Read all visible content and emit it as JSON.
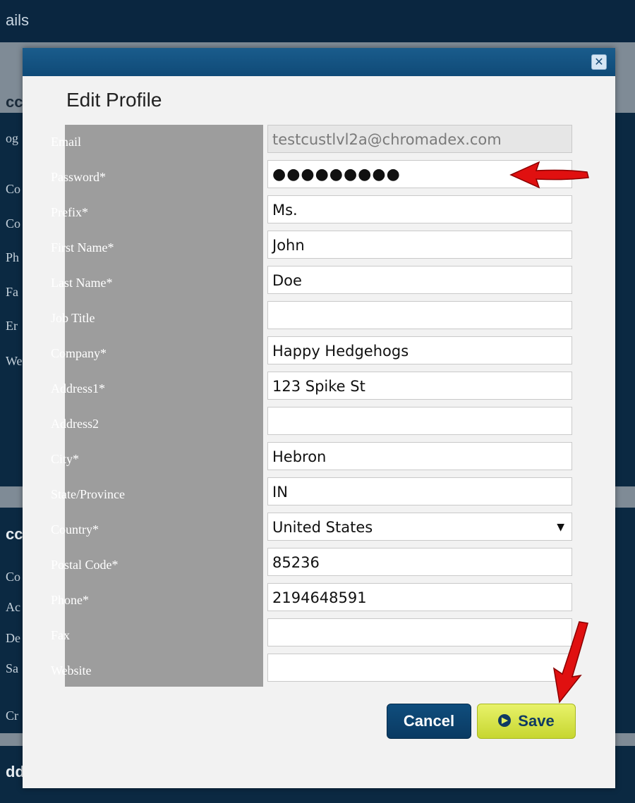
{
  "background": {
    "header_fragment": "ails",
    "side_fragments": [
      "cc",
      "og",
      "Co",
      "Co",
      "Ph",
      "Fa",
      "Er",
      "We",
      "cc",
      "Co",
      "Ac",
      "De",
      "Sa",
      "Cr",
      "dd"
    ]
  },
  "modal": {
    "title": "Edit Profile",
    "close_icon": "close-icon",
    "fields": [
      {
        "label": "Email",
        "value": "testcustlvl2a@chromadex.com",
        "readonly": true
      },
      {
        "label": "Password*",
        "value": "●●●●●●●●●",
        "type": "password"
      },
      {
        "label": "Prefix*",
        "value": "Ms."
      },
      {
        "label": "First Name*",
        "value": "John"
      },
      {
        "label": "Last Name*",
        "value": "Doe"
      },
      {
        "label": "Job Title",
        "value": ""
      },
      {
        "label": "Company*",
        "value": "Happy Hedgehogs"
      },
      {
        "label": "Address1*",
        "value": "123 Spike St"
      },
      {
        "label": "Address2",
        "value": ""
      },
      {
        "label": "City*",
        "value": "Hebron"
      },
      {
        "label": "State/Province",
        "value": "IN"
      },
      {
        "label": "Country*",
        "value": "United States",
        "type": "select"
      },
      {
        "label": "Postal Code*",
        "value": "85236"
      },
      {
        "label": "Phone*",
        "value": "2194648591"
      },
      {
        "label": "Fax",
        "value": ""
      },
      {
        "label": "Website",
        "value": ""
      }
    ],
    "cancel_label": "Cancel",
    "save_label": "Save"
  },
  "colors": {
    "titlebar": "#155483",
    "label_column": "#9d9d9d",
    "save_button": "#d4e04a",
    "cancel_button": "#0d4470",
    "annotation_arrow": "#e01010"
  }
}
